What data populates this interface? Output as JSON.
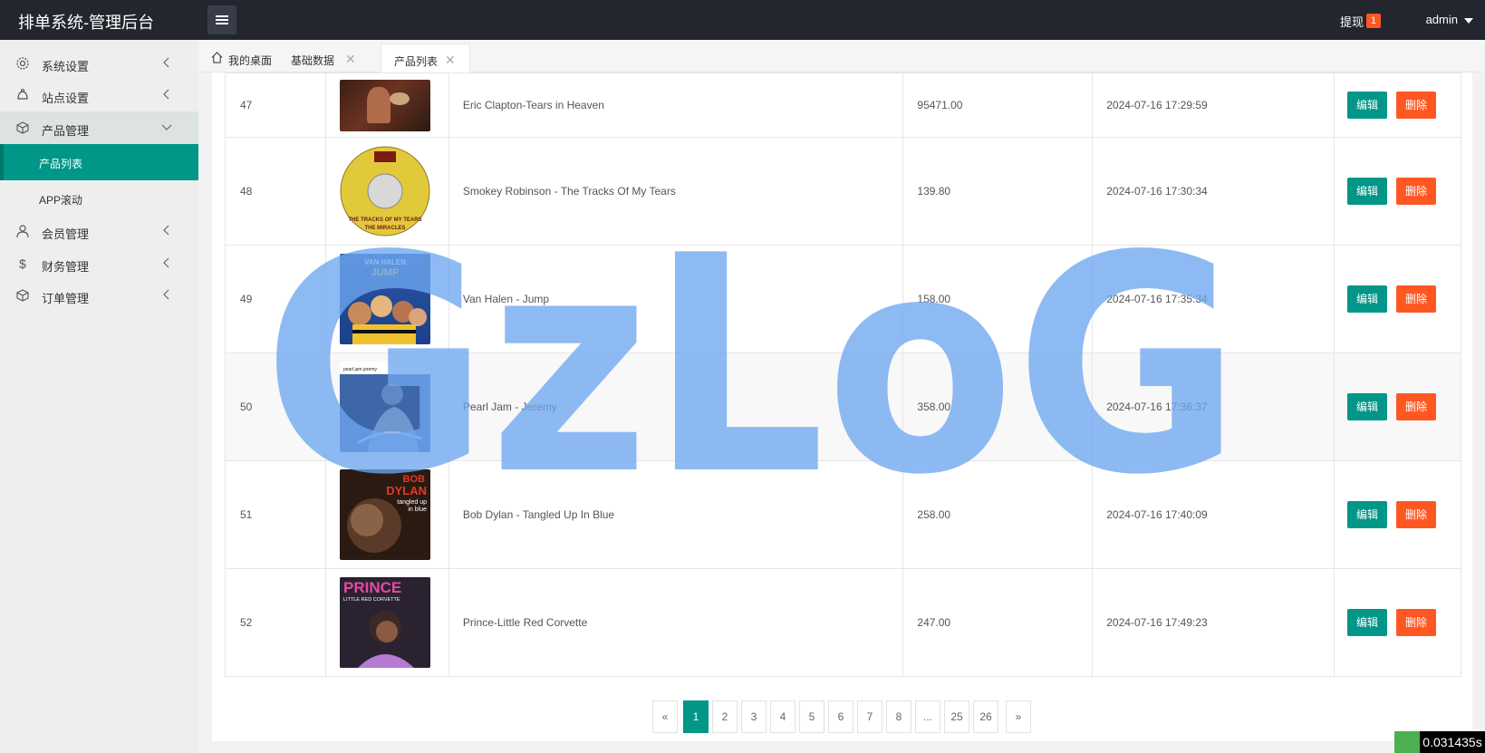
{
  "app": {
    "title": "排单系统-管理后台"
  },
  "header": {
    "withdraw_label": "提现",
    "withdraw_badge": "1",
    "user_name": "admin"
  },
  "sidebar": {
    "items": [
      {
        "label": "系统设置",
        "icon": "gear-icon"
      },
      {
        "label": "站点设置",
        "icon": "site-icon"
      },
      {
        "label": "产品管理",
        "icon": "box-icon",
        "expanded": true,
        "children": [
          {
            "label": "产品列表",
            "active": true
          },
          {
            "label": "APP滚动"
          }
        ]
      },
      {
        "label": "会员管理",
        "icon": "user-icon"
      },
      {
        "label": "财务管理",
        "icon": "dollar-icon"
      },
      {
        "label": "订单管理",
        "icon": "order-icon"
      }
    ]
  },
  "tabs": [
    {
      "label": "我的桌面",
      "icon": "home-icon"
    },
    {
      "label": "基础数据",
      "closable": true
    },
    {
      "label": "产品列表",
      "closable": true,
      "active": true
    }
  ],
  "table": {
    "rows": [
      {
        "id": "47",
        "name": "Eric Clapton-Tears in Heaven",
        "price": "95471.00",
        "time": "2024-07-16 17:29:59"
      },
      {
        "id": "48",
        "name": "Smokey Robinson - The Tracks Of My Tears",
        "price": "139.80",
        "time": "2024-07-16 17:30:34"
      },
      {
        "id": "49",
        "name": "Van Halen - Jump",
        "price": "158.00",
        "time": "2024-07-16 17:35:34"
      },
      {
        "id": "50",
        "name": "Pearl Jam - Jeremy",
        "price": "358.00",
        "time": "2024-07-16 17:36:37"
      },
      {
        "id": "51",
        "name": "Bob Dylan - Tangled Up In Blue",
        "price": "258.00",
        "time": "2024-07-16 17:40:09"
      },
      {
        "id": "52",
        "name": "Prince-Little Red Corvette",
        "price": "247.00",
        "time": "2024-07-16 17:49:23"
      }
    ],
    "edit_label": "编辑",
    "delete_label": "删除"
  },
  "thumb_text": {
    "smokey": "THE TRACKS OF MY TEARS",
    "smokey2": "THE MIRACLES",
    "vanhalen": "VAN HALEN",
    "vanhalen2": "JUMP",
    "pearljam": "pearl jam  jeremy",
    "dylan": "BOB",
    "dylan2": "DYLAN",
    "dylan3": "tangled up",
    "dylan4": "in blue",
    "prince": "PRINCE",
    "prince2": "LITTLE RED CORVETTE"
  },
  "pagination": {
    "prev": "«",
    "pages": [
      "1",
      "2",
      "3",
      "4",
      "5",
      "6",
      "7",
      "8",
      "...",
      "25",
      "26"
    ],
    "next": "»",
    "current": "1"
  },
  "watermark": "GzLoG",
  "footer": {
    "timing": "0.031435s"
  },
  "colors": {
    "topbar": "#23262e",
    "accent": "#009688",
    "danger": "#ff5722",
    "watermark": "#6ea6f0"
  }
}
